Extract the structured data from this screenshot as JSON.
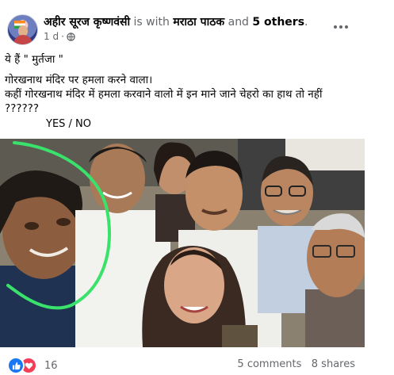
{
  "header": {
    "author": "अहीर सूरज कृष्णवंसी",
    "with_text": "is with",
    "tagged": "मराठा पाठक",
    "and_text": "and",
    "others": "5 others",
    "dot": ".",
    "time": "1 d",
    "separator": "·"
  },
  "post": {
    "lines": [
      "ये हैं \" मुर्तजा \"",
      "गोरखनाथ मंदिर पर हमला करने वाला।",
      "कहीं गोरखनाथ मंदिर में हमला करवाने वालो में इन माने जाने चेहरो का हाथ तो नहीं",
      "??????"
    ],
    "yes_no": "YES / NO"
  },
  "footer": {
    "reaction_count": "16",
    "comments": "5 comments",
    "shares": "8 shares"
  },
  "colors": {
    "highlight_circle": "#39e26a",
    "like": "#1877f2",
    "love": "#f33e58",
    "muted_text": "#65676b"
  },
  "icons": [
    "globe-icon",
    "more-icon",
    "like-icon",
    "love-icon"
  ]
}
